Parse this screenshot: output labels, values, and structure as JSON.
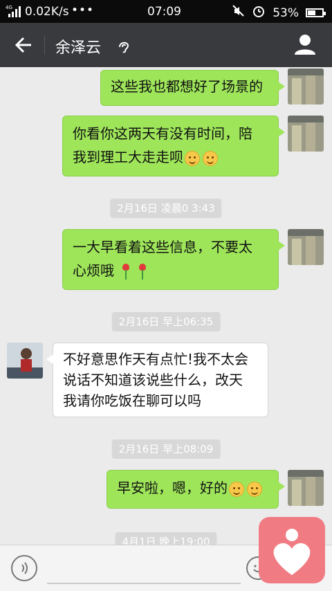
{
  "status_bar": {
    "signal": "4G",
    "network_speed": "0.02K/s",
    "more": "•••",
    "time": "07:09",
    "battery_percent": "53%",
    "battery_level": 0.53
  },
  "header": {
    "title": "余泽云"
  },
  "messages": [
    {
      "text": "这些我也都想好了场景的"
    },
    {
      "text_line1": "你看你这两天有没有时间，陪",
      "text_line2": "我到理工大走走呗"
    },
    {
      "text_line1": "一大早看着这些信息，不要太",
      "text_line2": "心烦哦"
    },
    {
      "text_line1": "不好意思作天有点忙!我不太会",
      "text_line2": "说话不知道该说些什么，改天",
      "text_line3": "我请你吃饭在聊可以吗"
    },
    {
      "text": "早安啦，嗯，好的"
    }
  ],
  "timestamps": [
    "2月16日 凌晨0 3:43",
    "2月16日 早上06:35",
    "2月16日 早上08:09",
    "4月1日 晚上19:00"
  ],
  "colors": {
    "my_bubble": "#9ee55a",
    "their_bubble": "#ffffff",
    "header_bg": "#393a3e",
    "float_app": "#f17b83"
  }
}
